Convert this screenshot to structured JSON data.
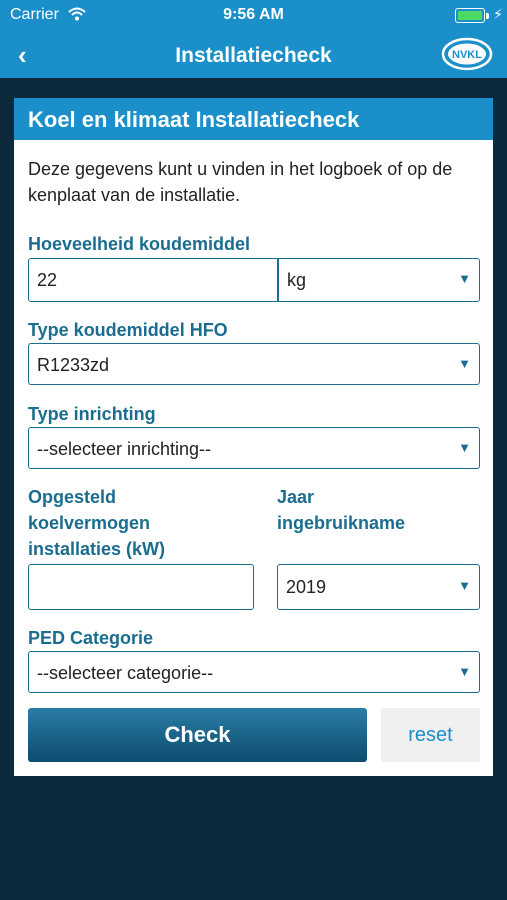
{
  "status_bar": {
    "carrier": "Carrier",
    "time": "9:56 AM",
    "battery_level": 1.0,
    "icons": [
      "wifi-icon",
      "battery-icon",
      "charging-icon"
    ]
  },
  "nav": {
    "back_icon": "chevron-left-icon",
    "title": "Installatiecheck",
    "logo_text": "NVKL"
  },
  "card": {
    "title": "Koel en klimaat Installatiecheck",
    "intro": "Deze gegevens kunt u vinden in het logboek of op de kenplaat van de installatie."
  },
  "form": {
    "quantity": {
      "label": "Hoeveelheid koudemiddel",
      "value": "22",
      "unit": "kg"
    },
    "refrigerant_type": {
      "label": "Type koudemiddel HFO",
      "value": "R1233zd"
    },
    "installation_type": {
      "label": "Type inrichting",
      "value": "--selecteer inrichting--"
    },
    "capacity": {
      "label_line1": "Opgesteld",
      "label_line2": "koelvermogen",
      "label_line3": "installaties (kW)",
      "value": ""
    },
    "commission_year": {
      "label_line1": "Jaar",
      "label_line2": "ingebruikname",
      "value": "2019"
    },
    "ped_category": {
      "label": "PED Categorie",
      "value": "--selecteer categorie--"
    }
  },
  "actions": {
    "check_label": "Check",
    "reset_label": "reset"
  },
  "colors": {
    "accent": "#1a8fc9",
    "label": "#1b6d8f",
    "background": "#0d2a3c"
  }
}
